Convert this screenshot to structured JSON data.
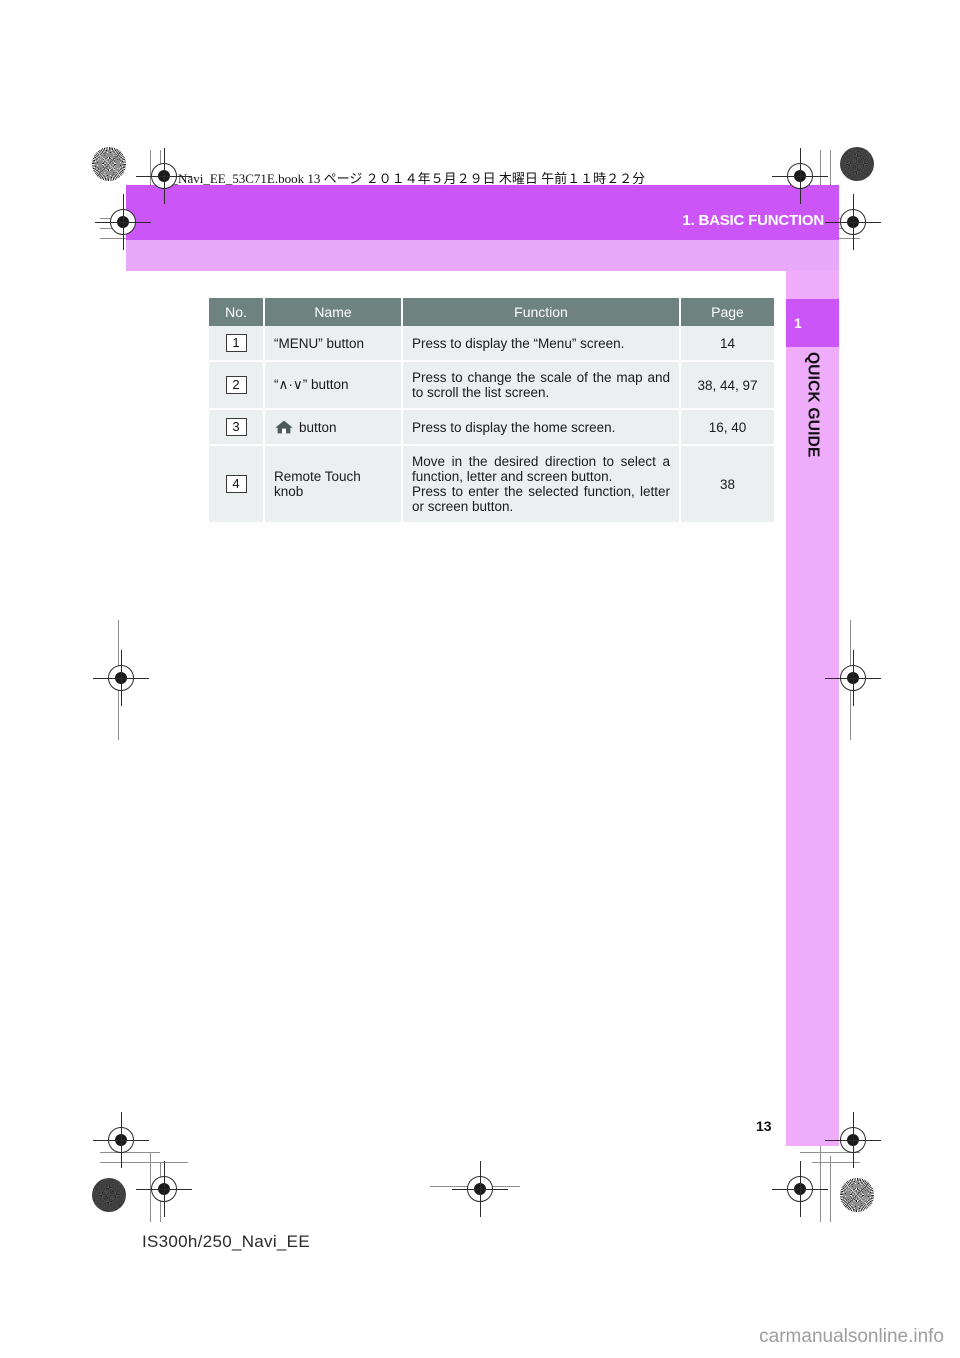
{
  "document": {
    "book_meta": "IS_Navi_EE_53C71E.book   13 ページ   ２０１４年５月２９日   木曜日   午前１１時２２分",
    "section_title": "1. BASIC FUNCTION",
    "chapter_number": "1",
    "chapter_label": "QUICK GUIDE",
    "page_number": "13",
    "model_code": "IS300h/250_Navi_EE",
    "watermark": "carmanualsonline.info"
  },
  "colors": {
    "band_purple": "#CB55F7",
    "band_purple_light": "#E9A9FB",
    "sidebar_purple": "#EEACFB",
    "table_header": "#6E8280",
    "table_cell": "#ECEFF0",
    "icon_slate": "#4B5B5A"
  },
  "table": {
    "headers": [
      "No.",
      "Name",
      "Function",
      "Page"
    ],
    "rows": [
      {
        "no": "1",
        "name": "“MENU” button",
        "name_icon": null,
        "function_lines": [
          "Press to display the “Menu” screen."
        ],
        "page": "14"
      },
      {
        "no": "2",
        "name": "“∧·∨” button",
        "name_icon": null,
        "function_lines": [
          "Press to change the scale of the map and to scroll the list screen."
        ],
        "page": "38, 44, 97"
      },
      {
        "no": "3",
        "name": "button",
        "name_icon": "home-icon",
        "function_lines": [
          "Press to display the home screen."
        ],
        "page": "16, 40"
      },
      {
        "no": "4",
        "name": "Remote Touch knob",
        "name_icon": null,
        "function_lines": [
          "Move in the desired direction to select a function, letter and screen button.",
          "Press to enter the selected function, letter or screen button."
        ],
        "page": "38"
      }
    ]
  }
}
